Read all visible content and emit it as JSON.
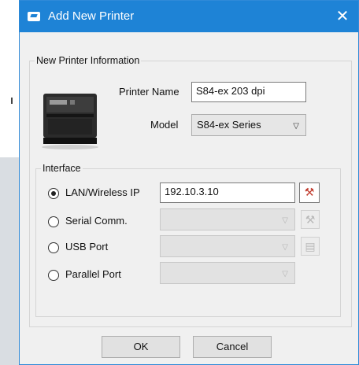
{
  "window": {
    "title": "Add New Printer",
    "close_glyph": "✕"
  },
  "info_group": {
    "legend": "New Printer Information",
    "printer_name_label": "Printer Name",
    "printer_name_value": "S84-ex 203 dpi",
    "model_label": "Model",
    "model_value": "S84-ex Series"
  },
  "interface_group": {
    "legend": "Interface",
    "options": [
      {
        "label": "LAN/Wireless IP",
        "checked": true
      },
      {
        "label": "Serial Comm.",
        "checked": false
      },
      {
        "label": "USB Port",
        "checked": false
      },
      {
        "label": "Parallel Port",
        "checked": false
      }
    ],
    "ip_value": "192.10.3.10"
  },
  "buttons": {
    "ok": "OK",
    "cancel": "Cancel"
  },
  "icons": {
    "app": "printer-app-icon",
    "settings_tools": "tools-icon",
    "usb_settings": "document-settings-icon",
    "dropdown": "chevron-down-icon"
  },
  "colors": {
    "titlebar": "#1e83d6",
    "dialog_bg": "#f0f0f0"
  }
}
